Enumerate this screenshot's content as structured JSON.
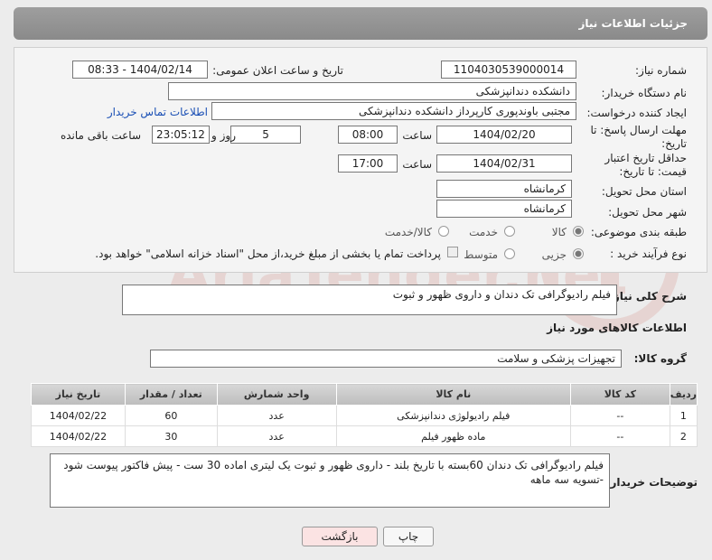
{
  "header": {
    "title": "جزئیات اطلاعات نیاز"
  },
  "form": {
    "need_number": {
      "label": "شماره نیاز:",
      "value": "1104030539000014"
    },
    "announce_datetime": {
      "label": "تاریخ و ساعت اعلان عمومی:",
      "value": "1404/02/14 - 08:33"
    },
    "buyer_org": {
      "label": "نام دستگاه خریدار:",
      "value": "دانشکده دندانپزشکی"
    },
    "requester": {
      "label": "ایجاد کننده درخواست:",
      "value": "مجتبی  باوندپوری کارپرداز دانشکده دندانپزشکی",
      "contact_link": "اطلاعات تماس خریدار"
    },
    "response_deadline": {
      "label": "مهلت ارسال پاسخ: تا تاریخ:",
      "date": "1404/02/20",
      "time_label": "ساعت",
      "time": "08:00",
      "days": "5",
      "days_label": "روز و",
      "remaining": "23:05:12",
      "remaining_label": "ساعت باقی مانده"
    },
    "price_validity": {
      "label": "حداقل تاریخ اعتبار قیمت: تا تاریخ:",
      "date": "1404/02/31",
      "time_label": "ساعت",
      "time": "17:00"
    },
    "delivery_province": {
      "label": "استان محل تحویل:",
      "value": "کرمانشاه"
    },
    "delivery_city": {
      "label": "شهر محل تحویل:",
      "value": "کرمانشاه"
    },
    "category": {
      "label": "طبقه بندی موضوعی:",
      "options": [
        "کالا",
        "خدمت",
        "کالا/خدمت"
      ],
      "selected": 0
    },
    "purchase_type": {
      "label": "نوع فرآیند خرید :",
      "options": [
        "جزیی",
        "متوسط"
      ],
      "selected": 0,
      "payment_note": "پرداخت تمام یا بخشی از مبلغ خرید،از محل \"اسناد خزانه اسلامی\" خواهد بود."
    }
  },
  "description": {
    "label": "شرح کلی نیاز:",
    "value": "فیلم رادیوگرافی تک دندان و داروی ظهور و ثبوت"
  },
  "goods_section": {
    "title": "اطلاعات کالاهای مورد نیاز",
    "group_label": "گروه کالا:",
    "group_value": "تجهیزات پزشکی و سلامت"
  },
  "table": {
    "headers": [
      "ردیف",
      "کد کالا",
      "نام کالا",
      "واحد شمارش",
      "تعداد / مقدار",
      "تاریخ نیاز"
    ],
    "rows": [
      [
        "1",
        "--",
        "فیلم رادیولوژی دندانپزشکی",
        "عدد",
        "60",
        "1404/02/22"
      ],
      [
        "2",
        "--",
        "ماده ظهور فیلم",
        "عدد",
        "30",
        "1404/02/22"
      ]
    ]
  },
  "buyer_notes": {
    "label": "توضیحات خریدار:",
    "value": "فیلم رادیوگرافی تک دندان 60بسته با تاریخ بلند - داروی ظهور و ثبوت یک لیتری اماده 30 ست -  پیش فاکتور پیوست شود -تسویه سه ماهه"
  },
  "buttons": {
    "print": "چاپ",
    "back": "بازگشت"
  },
  "watermark": {
    "text": "AriaTender.net",
    "color": "#c0392b"
  }
}
